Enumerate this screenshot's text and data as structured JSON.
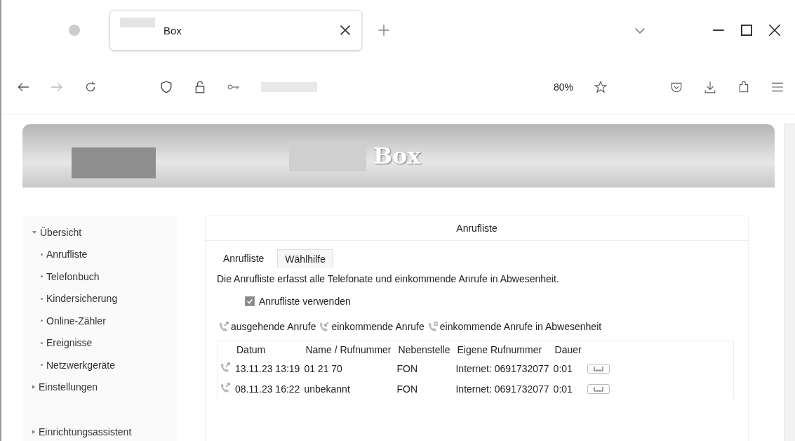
{
  "browser": {
    "tab": {
      "title": "Box"
    },
    "zoom": "80%"
  },
  "header": {
    "logo": "Box"
  },
  "sidebar": {
    "items": [
      {
        "label": "Übersicht",
        "expanded": true,
        "children": [
          {
            "label": "Anrufliste"
          },
          {
            "label": "Telefonbuch"
          },
          {
            "label": "Kindersicherung"
          },
          {
            "label": "Online-Zähler"
          },
          {
            "label": "Ereignisse"
          },
          {
            "label": "Netzwerkgeräte"
          }
        ]
      },
      {
        "label": "Einstellungen",
        "expanded": false
      },
      {
        "label": "Einrichtungsassistent",
        "expanded": false
      }
    ]
  },
  "panel": {
    "title": "Anrufliste",
    "tabs": [
      {
        "label": "Anrufliste",
        "selected": true
      },
      {
        "label": "Wählhilfe",
        "selected": false
      }
    ],
    "description": "Die Anrufliste erfasst alle Telefonate und einkommende Anrufe in Abwesenheit.",
    "checkbox": {
      "label": "Anrufliste verwenden",
      "checked": true
    },
    "legend": [
      {
        "kind": "outgoing",
        "label": "ausgehende Anrufe"
      },
      {
        "kind": "incoming",
        "label": "einkommende Anrufe"
      },
      {
        "kind": "missed",
        "label": "einkommende Anrufe in Abwesenheit"
      }
    ],
    "table": {
      "columns": [
        "Datum",
        "Name / Rufnummer",
        "Nebenstelle",
        "Eigene Rufnummer",
        "Dauer"
      ],
      "rows": [
        {
          "kind": "outgoing",
          "cells": [
            "13.11.23 13:19",
            "01 21 70",
            "FON",
            "Internet: 0691732077",
            "0:01"
          ]
        },
        {
          "kind": "outgoing",
          "cells": [
            "08.11.23 16:22",
            "unbekannt",
            "FON",
            "Internet: 0691732077",
            "0:01"
          ]
        }
      ]
    }
  }
}
